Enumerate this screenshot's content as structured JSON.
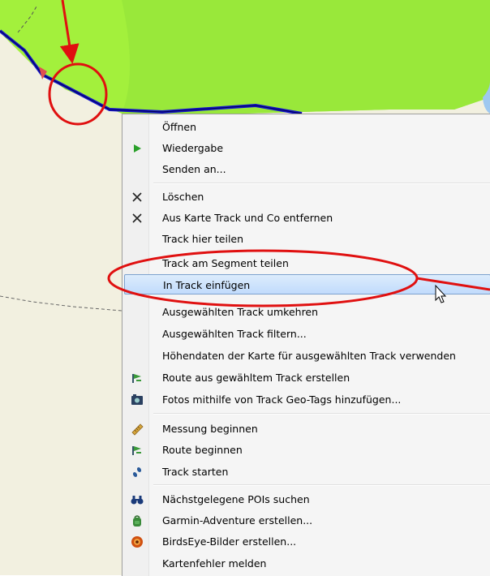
{
  "menu": {
    "items": [
      {
        "label": "Öffnen",
        "icon": "none"
      },
      {
        "label": "Wiedergabe",
        "icon": "play-icon"
      },
      {
        "label": "Senden an...",
        "icon": "none"
      },
      {
        "label": "Löschen",
        "icon": "delete-icon"
      },
      {
        "label": "Aus Karte Track und Co entfernen",
        "icon": "remove-icon"
      },
      {
        "label": "Track hier teilen",
        "icon": "none"
      },
      {
        "label": "Track am Segment teilen",
        "icon": "none"
      },
      {
        "label": "In Track einfügen",
        "icon": "none",
        "highlighted": true
      },
      {
        "label": "Ausgewählten Track umkehren",
        "icon": "none"
      },
      {
        "label": "Ausgewählten Track filtern...",
        "icon": "none"
      },
      {
        "label": "Höhendaten der Karte für ausgewählten Track verwenden",
        "icon": "none"
      },
      {
        "label": "Route aus gewähltem Track erstellen",
        "icon": "route-flag-icon"
      },
      {
        "label": "Fotos mithilfe von Track Geo-Tags hinzufügen...",
        "icon": "photo-icon"
      },
      {
        "label": "Messung beginnen",
        "icon": "ruler-icon"
      },
      {
        "label": "Route beginnen",
        "icon": "route-flag-icon"
      },
      {
        "label": "Track starten",
        "icon": "footprints-icon"
      },
      {
        "label": "Nächstgelegene POIs suchen",
        "icon": "binoculars-icon"
      },
      {
        "label": "Garmin-Adventure erstellen...",
        "icon": "backpack-icon"
      },
      {
        "label": "BirdsEye-Bilder erstellen...",
        "icon": "birdseye-icon"
      },
      {
        "label": "Kartenfehler melden",
        "icon": "none"
      }
    ]
  },
  "colors": {
    "map_background": "#f2f0e0",
    "map_green": "#a3f03c",
    "track_blue": "#1414c8",
    "annotation_red": "#e01010",
    "highlight": "#c8e0fa"
  }
}
